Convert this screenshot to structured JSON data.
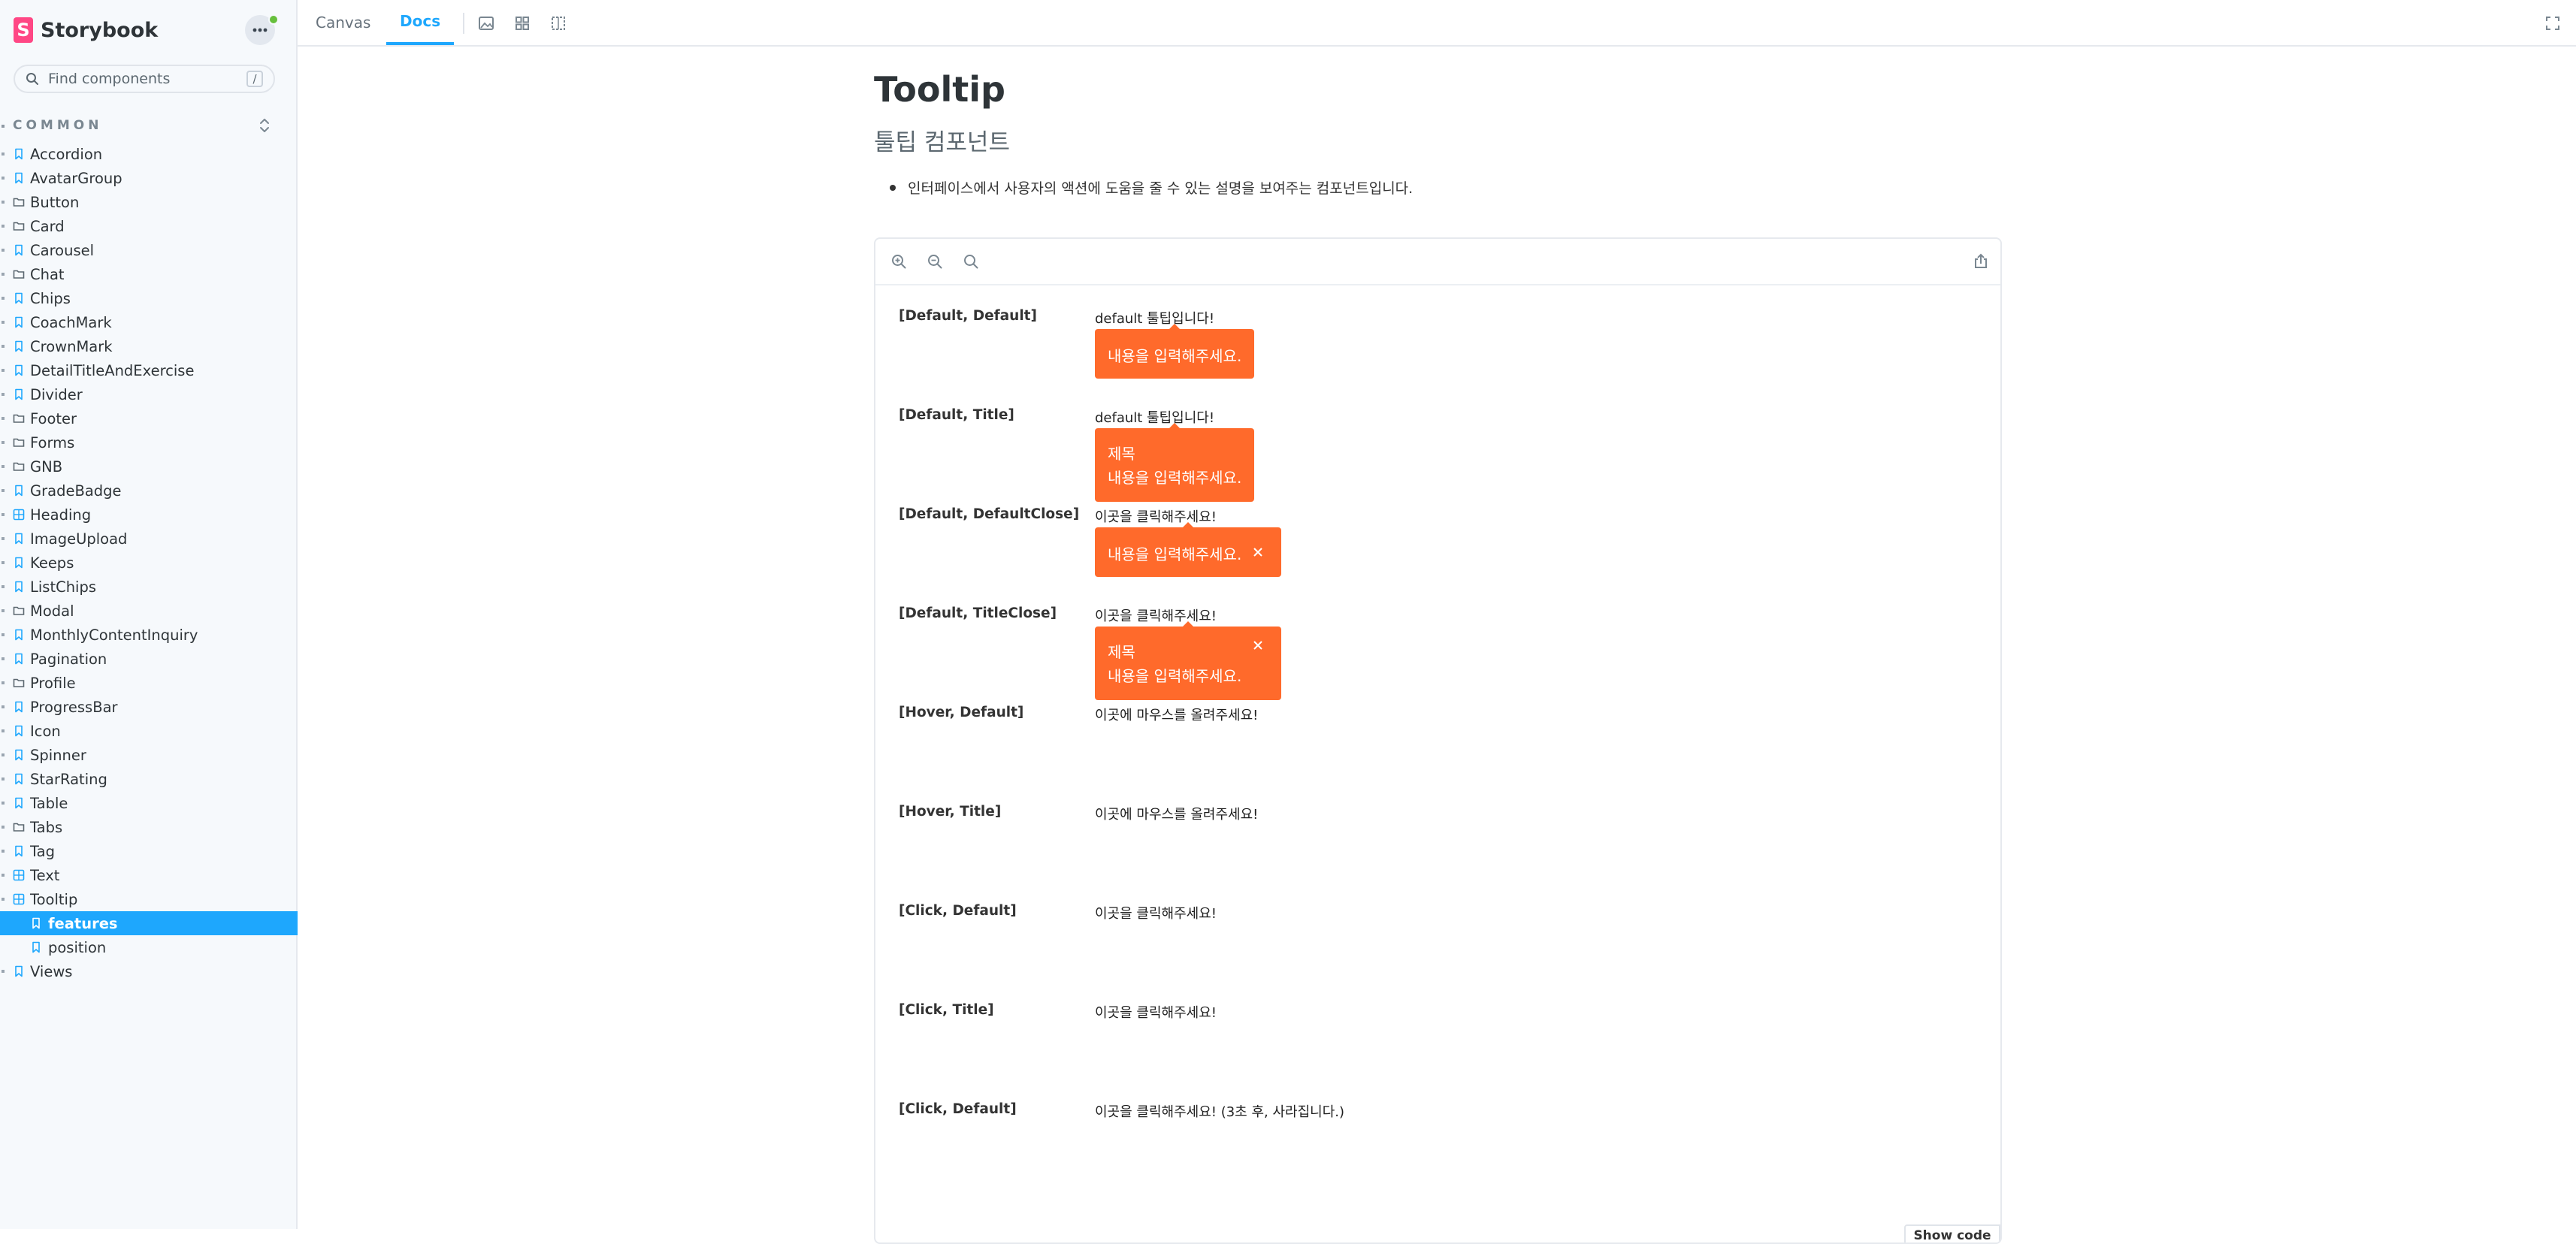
{
  "sidebar": {
    "brand": "Storybook",
    "brand_logo": "S",
    "search_placeholder": "Find components",
    "search_shortcut": "/",
    "group_label": "COMMON",
    "items": [
      {
        "label": "Accordion",
        "icon": "bookmark-icon"
      },
      {
        "label": "AvatarGroup",
        "icon": "bookmark-icon"
      },
      {
        "label": "Button",
        "icon": "folder-icon"
      },
      {
        "label": "Card",
        "icon": "folder-icon"
      },
      {
        "label": "Carousel",
        "icon": "bookmark-icon"
      },
      {
        "label": "Chat",
        "icon": "folder-icon"
      },
      {
        "label": "Chips",
        "icon": "bookmark-icon"
      },
      {
        "label": "CoachMark",
        "icon": "bookmark-icon"
      },
      {
        "label": "CrownMark",
        "icon": "bookmark-icon"
      },
      {
        "label": "DetailTitleAndExercise",
        "icon": "bookmark-icon"
      },
      {
        "label": "Divider",
        "icon": "bookmark-icon"
      },
      {
        "label": "Footer",
        "icon": "folder-icon"
      },
      {
        "label": "Forms",
        "icon": "folder-icon"
      },
      {
        "label": "GNB",
        "icon": "folder-icon"
      },
      {
        "label": "GradeBadge",
        "icon": "bookmark-icon"
      },
      {
        "label": "Heading",
        "icon": "component-icon"
      },
      {
        "label": "ImageUpload",
        "icon": "bookmark-icon"
      },
      {
        "label": "Keeps",
        "icon": "bookmark-icon"
      },
      {
        "label": "ListChips",
        "icon": "bookmark-icon"
      },
      {
        "label": "Modal",
        "icon": "folder-icon"
      },
      {
        "label": "MonthlyContentInquiry",
        "icon": "bookmark-icon"
      },
      {
        "label": "Pagination",
        "icon": "bookmark-icon"
      },
      {
        "label": "Profile",
        "icon": "folder-icon"
      },
      {
        "label": "ProgressBar",
        "icon": "bookmark-icon"
      },
      {
        "label": "Icon",
        "icon": "bookmark-icon"
      },
      {
        "label": "Spinner",
        "icon": "bookmark-icon"
      },
      {
        "label": "StarRating",
        "icon": "bookmark-icon"
      },
      {
        "label": "Table",
        "icon": "bookmark-icon"
      },
      {
        "label": "Tabs",
        "icon": "folder-icon"
      },
      {
        "label": "Tag",
        "icon": "bookmark-icon"
      },
      {
        "label": "Text",
        "icon": "component-icon"
      },
      {
        "label": "Tooltip",
        "icon": "component-icon"
      },
      {
        "label": "features",
        "icon": "bookmark-icon",
        "child": true,
        "selected": true
      },
      {
        "label": "position",
        "icon": "bookmark-icon",
        "child": true
      },
      {
        "label": "Views",
        "icon": "bookmark-icon"
      }
    ]
  },
  "toolbar": {
    "tabs": [
      "Canvas",
      "Docs"
    ],
    "active_tab": "Docs"
  },
  "docs": {
    "title": "Tooltip",
    "subtitle": "툴팁 컴포넌트",
    "description": "인터페이스에서 사용자의 액션에 도움을 줄 수 있는 설명을 보여주는 컴포넌트입니다."
  },
  "stories": [
    {
      "label": "[Default, Default]",
      "trigger": "default 툴팁입니다!",
      "tooltip": {
        "body": "내용을 입력해주세요."
      }
    },
    {
      "label": "[Default, Title]",
      "trigger": "default 툴팁입니다!",
      "tooltip": {
        "title": "제목",
        "body": "내용을 입력해주세요."
      }
    },
    {
      "label": "[Default, DefaultClose]",
      "trigger": "이곳을 클릭해주세요!",
      "tooltip": {
        "body": "내용을 입력해주세요.",
        "close": true
      }
    },
    {
      "label": "[Default, TitleClose]",
      "trigger": "이곳을 클릭해주세요!",
      "tooltip": {
        "title": "제목",
        "body": "내용을 입력해주세요.",
        "close": true
      }
    },
    {
      "label": "[Hover, Default]",
      "trigger": "이곳에 마우스를 올려주세요!"
    },
    {
      "label": "[Hover, Title]",
      "trigger": "이곳에 마우스를 올려주세요!"
    },
    {
      "label": "[Click, Default]",
      "trigger": "이곳을 클릭해주세요!"
    },
    {
      "label": "[Click, Title]",
      "trigger": "이곳을 클릭해주세요!"
    },
    {
      "label": "[Click, Default]",
      "trigger": "이곳을 클릭해주세요! (3초 후, 사라집니다.)"
    }
  ],
  "show_code_label": "Show code",
  "colors": {
    "accent": "#1ea7fd",
    "brand": "#ff4785",
    "tooltip": "#ff6a2b",
    "status_dot": "#66bf3c"
  }
}
